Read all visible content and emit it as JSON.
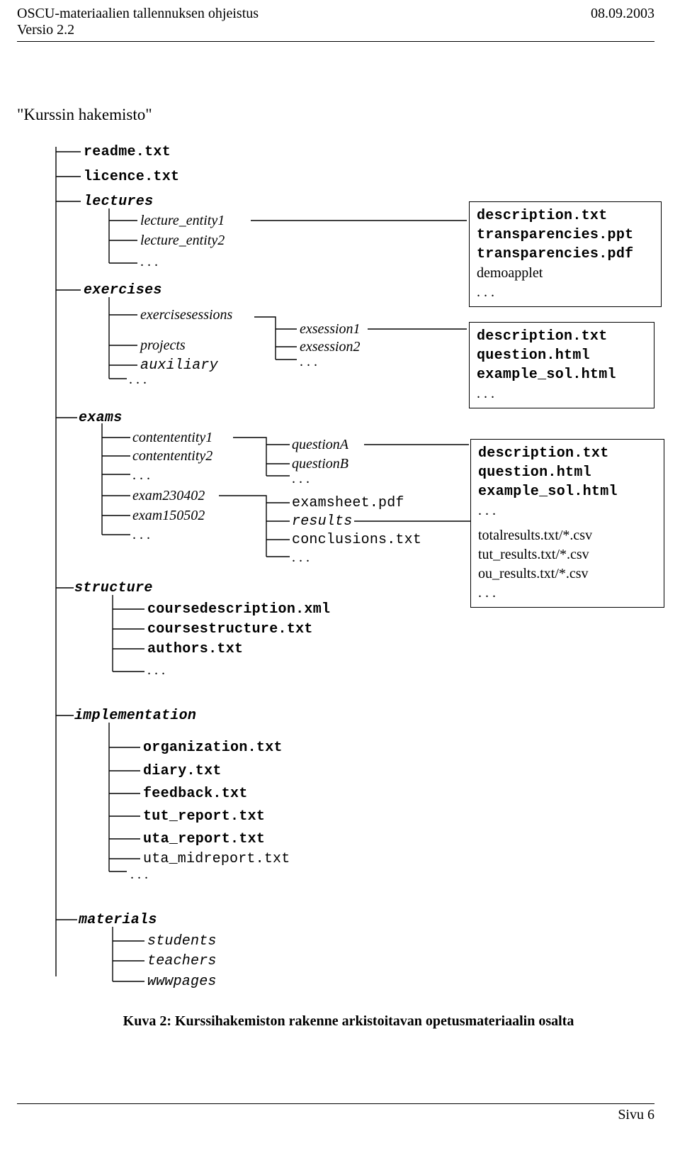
{
  "header": {
    "title": "OSCU-materiaalien tallennuksen ohjeistus",
    "version": "Versio 2.2",
    "date": "08.09.2003"
  },
  "footer": {
    "page_label": "Sivu 6"
  },
  "page_title": "\"Kurssin hakemisto\"",
  "tree": {
    "readme": "readme.txt",
    "licence": "licence.txt",
    "lectures": {
      "label": "lectures",
      "items": [
        "lecture_entity1",
        "lecture_entity2",
        ". . ."
      ]
    },
    "exercises": {
      "label": "exercises",
      "items": [
        "exercisesessions",
        "projects",
        "auxiliary",
        ". . ."
      ],
      "sessions": [
        "exsession1",
        "exsession2",
        ". . ."
      ]
    },
    "exams": {
      "label": "exams",
      "entities": [
        "contententity1",
        "contententity2",
        ". . .",
        "exam230402",
        "exam150502",
        ". . ."
      ],
      "questions": [
        "questionA",
        "questionB",
        ". . ."
      ],
      "examfiles": [
        "examsheet.pdf",
        "results",
        "conclusions.txt",
        ". . ."
      ]
    },
    "structure": {
      "label": "structure",
      "items": [
        "coursedescription.xml",
        "coursestructure.txt",
        "authors.txt",
        ". . ."
      ]
    },
    "implementation": {
      "label": "implementation",
      "items": [
        "organization.txt",
        "diary.txt",
        "feedback.txt",
        "tut_report.txt",
        "uta_report.txt",
        "uta_midreport.txt",
        ". . ."
      ]
    },
    "materials": {
      "label": "materials",
      "items": [
        "students",
        "teachers",
        "wwwpages"
      ]
    }
  },
  "boxes": {
    "lecture": {
      "lines": [
        "description.txt",
        "transparencies.ppt",
        "transparencies.pdf",
        "demoapplet",
        ". . ."
      ]
    },
    "session": {
      "lines": [
        "description.txt",
        "question.html",
        "example_sol.html",
        ". . ."
      ]
    },
    "exam_q": {
      "lines": [
        "description.txt",
        "question.html",
        "example_sol.html",
        ". . ."
      ]
    },
    "exam_r": {
      "lines": [
        "totalresults.txt/*.csv",
        "tut_results.txt/*.csv",
        "ou_results.txt/*.csv",
        ". . ."
      ]
    }
  },
  "caption": "Kuva 2: Kurssihakemiston rakenne arkistoitavan opetusmateriaalin osalta"
}
